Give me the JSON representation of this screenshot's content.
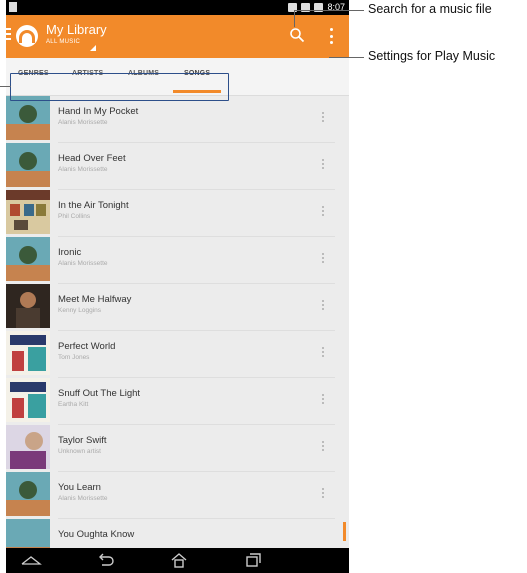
{
  "status_bar": {
    "time": "8:07"
  },
  "action_bar": {
    "title": "My Library",
    "subtitle": "ALL MUSIC",
    "accent": "#f28a2a"
  },
  "tabs": [
    {
      "label": "GENRES"
    },
    {
      "label": "ARTISTS"
    },
    {
      "label": "ALBUMS"
    },
    {
      "label": "SONGS",
      "selected": true
    }
  ],
  "songs": [
    {
      "title": "Hand In My Pocket",
      "artist": "Alanis Morissette"
    },
    {
      "title": "Head Over Feet",
      "artist": "Alanis Morissette"
    },
    {
      "title": "In the Air Tonight",
      "artist": "Phil Collins"
    },
    {
      "title": "Ironic",
      "artist": "Alanis Morissette"
    },
    {
      "title": "Meet Me Halfway",
      "artist": "Kenny Loggins"
    },
    {
      "title": "Perfect World",
      "artist": "Tom Jones"
    },
    {
      "title": "Snuff Out The Light",
      "artist": "Eartha Kitt"
    },
    {
      "title": "Taylor Swift",
      "artist": "Unknown artist"
    },
    {
      "title": "You Learn",
      "artist": "Alanis Morissette"
    },
    {
      "title": "You Oughta Know",
      "artist": ""
    }
  ],
  "annotations": {
    "search": "Search for a music file",
    "settings": "Settings for Play Music"
  }
}
